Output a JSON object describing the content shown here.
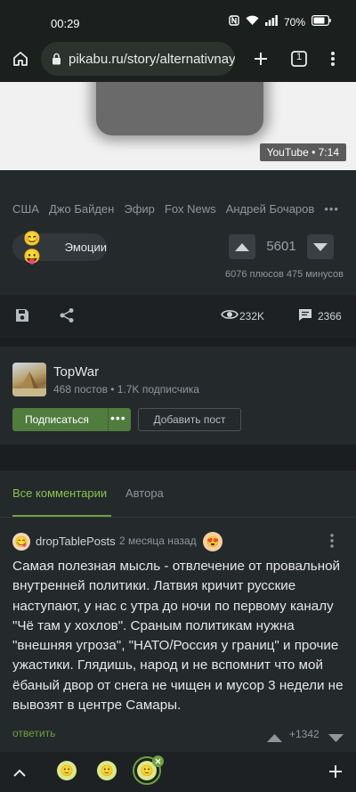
{
  "status_bar": {
    "time": "00:29",
    "battery": "70%"
  },
  "browser": {
    "url": "pikabu.ru/story/alternativnaya",
    "tab_count": "1"
  },
  "video": {
    "badge": "YouTube • 7:14"
  },
  "post": {
    "tags": [
      "США",
      "Джо Байден",
      "Эфир",
      "Fox News",
      "Андрей Бочаров"
    ],
    "tags_more": "•••",
    "emotions_label": "Эмоции",
    "rating": "5601",
    "votes_summary": "6076 плюсов 475 минусов"
  },
  "actions": {
    "views": "232K",
    "comments": "2366"
  },
  "community": {
    "name": "TopWar",
    "meta": "468 постов  •  1.7K подписчика",
    "subscribe_label": "Подписаться",
    "subscribe_more": "•••",
    "add_post_label": "Добавить пост"
  },
  "comments": {
    "tabs": [
      "Все комментарии",
      "Автора"
    ],
    "items": [
      {
        "author": "dropTablePosts",
        "date": "2 месяца назад",
        "text": "Самая полезная мысль - отвлечение от провальной внутренней политики. Латвия кричит русские наступают, у нас с утра до ночи по первому каналу \"Чё там у хохлов\". Сраным политикам нужна \"внешняя угроза\", \"НАТО/Россия у границ\" и прочие ужастики. Глядишь, народ и не вспомнит что мой ёбаный двор от снега не чищен и мусор 3 недели не вывозят в центре Самары.",
        "reply_label": "ответить",
        "rating": "+1342"
      }
    ]
  },
  "icons": {
    "home": "home-icon",
    "lock": "lock-icon",
    "new_tab": "plus-icon",
    "menu": "kebab-icon",
    "save": "save-icon",
    "share": "share-icon",
    "views": "eye-icon",
    "comments": "comment-icon"
  }
}
